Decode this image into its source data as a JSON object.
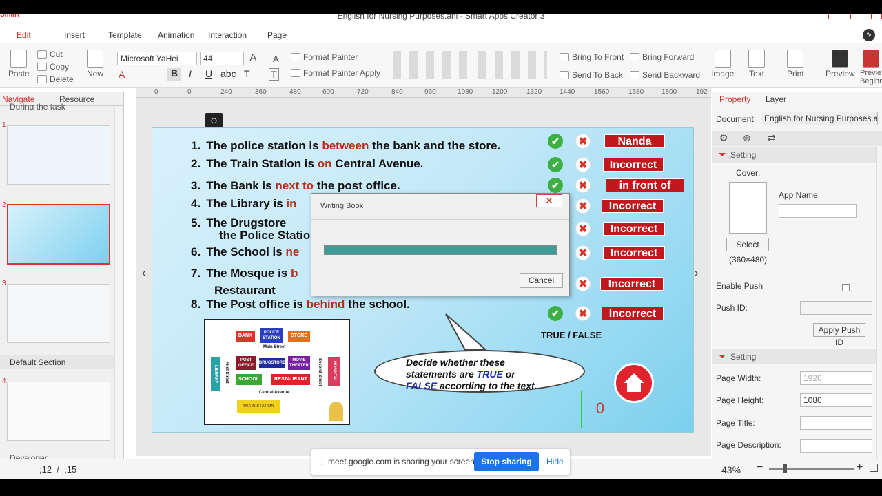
{
  "window": {
    "title": "English for Nursing Purposes.ani - Smart Apps Creator 3",
    "logo": "Smart"
  },
  "menu": [
    "Edit",
    "Insert",
    "Template",
    "Animation",
    "Interaction",
    "Page"
  ],
  "ribbon": {
    "paste": "Paste",
    "cut": "Cut",
    "copy": "Copy",
    "delete": "Delete",
    "new": "New",
    "font": "Microsoft YaHei",
    "size": "44",
    "format_painter": "Format Painter",
    "format_painter_apply": "Format Painter Apply",
    "bring_to_front": "Bring To Front",
    "bring_forward": "Bring Forward",
    "send_to_back": "Send To Back",
    "send_backward": "Send Backward",
    "image": "Image",
    "text": "Text",
    "print": "Print",
    "preview": "Preview",
    "preview_beginning": "Previe Beginn"
  },
  "ruler": [
    "0",
    "0",
    "240",
    "360",
    "480",
    "600",
    "720",
    "840",
    "960",
    "1080",
    "1200",
    "1320",
    "1440",
    "1560",
    "1680",
    "1800",
    "192"
  ],
  "left_panel": {
    "tabs": [
      "Navigate",
      "Resource"
    ],
    "top_label": "During the task",
    "section": "Default Section",
    "bottom_label": "Developer",
    "thumbnails": [
      "1",
      "2",
      "3",
      "4"
    ]
  },
  "slide": {
    "questions": [
      {
        "num": "1.",
        "pre": "The police station is ",
        "hl": "between",
        "post": " the bank and the store."
      },
      {
        "num": "2.",
        "pre": "The Train Station is ",
        "hl": "on",
        "post": " Central Avenue."
      },
      {
        "num": "3.",
        "pre": "The Bank is ",
        "hl": "next to",
        "post": " the post office."
      },
      {
        "num": "4.",
        "pre": "The Library is ",
        "hl": "in",
        "post": ""
      },
      {
        "num": "5.",
        "pre": "The Drugstore",
        "hl": "",
        "post": ""
      },
      {
        "num": "",
        "pre": "the Police Statio",
        "hl": "",
        "post": ""
      },
      {
        "num": "6.",
        "pre": "The School is ",
        "hl": "ne",
        "post": ""
      },
      {
        "num": "7.",
        "pre": "The Mosque is ",
        "hl": "b",
        "post": ""
      },
      {
        "num": "",
        "pre": "Restaurant",
        "hl": "",
        "post": ""
      },
      {
        "num": "8.",
        "pre": "The Post office is ",
        "hl": "behind",
        "post": " the school."
      }
    ],
    "answers": [
      "Nanda",
      "Incorrect",
      "in front of",
      "Incorrect",
      "Incorrect",
      "Incorrect",
      "Incorrect",
      "Incorrect"
    ],
    "check_glyph": "✔",
    "cross_glyph": "✖",
    "true_false": "TRUE / FALSE",
    "bubble": {
      "line1": "Decide whether these",
      "line2a": "statements are ",
      "true_word": "TRUE",
      "line2b": " or",
      "false_word": "FALSE",
      "line3": " according to the text."
    },
    "score": "0",
    "map": {
      "bank": "BANK",
      "police": "POLICE STATION",
      "store": "STORE",
      "main_street": "Main Street",
      "library": "LIBRARY",
      "post_office": "POST OFFICE",
      "drugstore": "DRUGSTORE",
      "movie": "MOVIE THEATER",
      "hospital": "HOSPITAL",
      "school": "SCHOOL",
      "restaurant": "RESTAURANT",
      "central": "Central Avenue",
      "train": "TRAIN STATION",
      "first_street": "First Street",
      "second_street": "Second Street"
    }
  },
  "dialog": {
    "title": "Writing Book",
    "close": "✕",
    "cancel": "Cancel",
    "progress": 1.0
  },
  "right_panel": {
    "tabs": [
      "Property",
      "Layer"
    ],
    "document_label": "Document:",
    "document_value": "English for Nursing Purposes.a",
    "setting1": "Setting",
    "cover_label": "Cover:",
    "app_name_label": "App Name:",
    "select": "Select",
    "cover_size": "(360×480)",
    "enable_push": "Enable Push",
    "push_id": "Push ID:",
    "apply_push": "Apply Push ID",
    "setting2": "Setting",
    "page_width_label": "Page Width:",
    "page_width": "1920",
    "page_height_label": "Page Height:",
    "page_height": "1080",
    "page_title_label": "Page Title:",
    "page_desc_label": "Page Description:"
  },
  "status": {
    "position": ";12  /  ;15",
    "zoom": "43%"
  },
  "share": {
    "text": "meet.google.com is sharing your screen.",
    "stop": "Stop sharing",
    "hide": "Hide"
  },
  "colors": {
    "accent": "#c0392b",
    "answer_bg": "#c0181c",
    "check": "#3cb043",
    "progress": "#3d9c97",
    "share_blue": "#1a73e8"
  }
}
